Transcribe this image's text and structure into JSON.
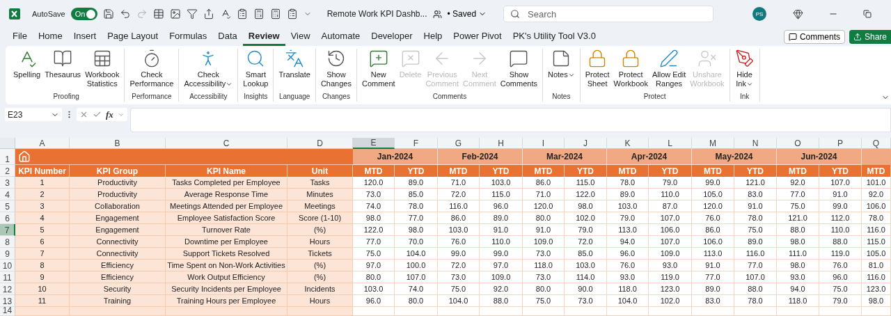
{
  "titlebar": {
    "autosave_label": "AutoSave",
    "autosave": {
      "label": "On",
      "on": true
    },
    "document_title": "Remote Work KPI Dashb...",
    "save_status": "• Saved",
    "search": {
      "placeholder": "Search"
    },
    "user_initials": "PS"
  },
  "menu_tabs": [
    {
      "label": "File",
      "selected": false
    },
    {
      "label": "Home",
      "selected": false
    },
    {
      "label": "Insert",
      "selected": false
    },
    {
      "label": "Page Layout",
      "selected": false
    },
    {
      "label": "Formulas",
      "selected": false
    },
    {
      "label": "Data",
      "selected": false
    },
    {
      "label": "Review",
      "selected": true
    },
    {
      "label": "View",
      "selected": false
    },
    {
      "label": "Automate",
      "selected": false
    },
    {
      "label": "Developer",
      "selected": false
    },
    {
      "label": "Help",
      "selected": false
    },
    {
      "label": "Power Pivot",
      "selected": false
    },
    {
      "label": "PK's Utility Tool V3.0",
      "selected": false
    }
  ],
  "comments_button": "Comments",
  "share_button": "Share",
  "ribbon_groups": [
    {
      "label": "Proofing",
      "commands": [
        {
          "label": "Spelling",
          "disabled": false,
          "dropdown": false
        },
        {
          "label": "Thesaurus",
          "disabled": false,
          "dropdown": false
        },
        {
          "label": "Workbook\nStatistics",
          "disabled": false,
          "dropdown": false
        }
      ]
    },
    {
      "label": "Performance",
      "commands": [
        {
          "label": "Check\nPerformance",
          "disabled": false,
          "dropdown": false
        }
      ]
    },
    {
      "label": "Accessibility",
      "commands": [
        {
          "label": "Check\nAccessibility",
          "disabled": false,
          "dropdown": true
        }
      ]
    },
    {
      "label": "Insights",
      "commands": [
        {
          "label": "Smart\nLookup",
          "disabled": false,
          "dropdown": false
        }
      ]
    },
    {
      "label": "Language",
      "commands": [
        {
          "label": "Translate",
          "disabled": false,
          "dropdown": false
        }
      ]
    },
    {
      "label": "Changes",
      "commands": [
        {
          "label": "Show\nChanges",
          "disabled": false,
          "dropdown": false
        }
      ]
    },
    {
      "label": "Comments",
      "commands": [
        {
          "label": "New\nComment",
          "disabled": false,
          "dropdown": false
        },
        {
          "label": "Delete",
          "disabled": true,
          "dropdown": false
        },
        {
          "label": "Previous\nComment",
          "disabled": true,
          "dropdown": false
        },
        {
          "label": "Next\nComment",
          "disabled": true,
          "dropdown": false
        },
        {
          "label": "Show\nComments",
          "disabled": false,
          "dropdown": false
        }
      ]
    },
    {
      "label": "Notes",
      "commands": [
        {
          "label": "Notes",
          "disabled": false,
          "dropdown": true
        }
      ]
    },
    {
      "label": "Protect",
      "commands": [
        {
          "label": "Protect\nSheet",
          "disabled": false,
          "dropdown": false
        },
        {
          "label": "Protect\nWorkbook",
          "disabled": false,
          "dropdown": false
        },
        {
          "label": "Allow Edit\nRanges",
          "disabled": false,
          "dropdown": false
        },
        {
          "label": "Unshare\nWorkbook",
          "disabled": true,
          "dropdown": false
        }
      ]
    },
    {
      "label": "Ink",
      "commands": [
        {
          "label": "Hide\nInk",
          "disabled": false,
          "dropdown": true
        }
      ]
    }
  ],
  "formula_bar": {
    "name_box": "E23",
    "fx": "fx"
  },
  "sheet": {
    "columns": [
      {
        "label": "A",
        "selected": false
      },
      {
        "label": "B",
        "selected": false
      },
      {
        "label": "C",
        "selected": false
      },
      {
        "label": "D",
        "selected": false
      },
      {
        "label": "E",
        "selected": true
      },
      {
        "label": "F",
        "selected": false
      },
      {
        "label": "G",
        "selected": false
      },
      {
        "label": "H",
        "selected": false
      },
      {
        "label": "I",
        "selected": false
      },
      {
        "label": "J",
        "selected": false
      },
      {
        "label": "K",
        "selected": false
      },
      {
        "label": "L",
        "selected": false
      },
      {
        "label": "M",
        "selected": false
      },
      {
        "label": "N",
        "selected": false
      },
      {
        "label": "O",
        "selected": false
      },
      {
        "label": "P",
        "selected": false
      },
      {
        "label": "Q",
        "selected": false
      }
    ],
    "header_row_numbers": [
      {
        "label": "1",
        "selected": false
      },
      {
        "label": "2",
        "selected": false
      }
    ],
    "months": [
      "Jan-2024",
      "Feb-2024",
      "Mar-2024",
      "Apr-2024",
      "May-2024",
      "Jun-2024"
    ],
    "headers": [
      "KPI Number",
      "KPI Group",
      "KPI Name",
      "Unit"
    ],
    "measures": [
      "MTD",
      "YTD",
      "MTD",
      "YTD",
      "MTD",
      "YTD",
      "MTD",
      "YTD",
      "MTD",
      "YTD",
      "MTD",
      "YTD",
      "MTD"
    ],
    "rows": [
      {
        "row": "3",
        "selected": false,
        "cells": [
          "1",
          "Productivity",
          "Tasks Completed per Employee",
          "Tasks"
        ],
        "values": [
          "120.0",
          "89.0",
          "71.0",
          "103.0",
          "86.0",
          "115.0",
          "78.0",
          "79.0",
          "99.0",
          "121.0",
          "92.0",
          "107.0",
          "101.0"
        ]
      },
      {
        "row": "4",
        "selected": false,
        "cells": [
          "2",
          "Productivity",
          "Average Response Time",
          "Minutes"
        ],
        "values": [
          "73.0",
          "85.0",
          "72.0",
          "115.0",
          "71.0",
          "122.0",
          "89.0",
          "110.0",
          "105.0",
          "83.0",
          "77.0",
          "91.0",
          "92.0"
        ]
      },
      {
        "row": "5",
        "selected": false,
        "cells": [
          "3",
          "Collaboration",
          "Meetings Attended per Employee",
          "Meetings"
        ],
        "values": [
          "74.0",
          "78.0",
          "116.0",
          "96.0",
          "120.0",
          "98.0",
          "103.0",
          "87.0",
          "120.0",
          "91.0",
          "75.0",
          "99.0",
          "106.0"
        ]
      },
      {
        "row": "6",
        "selected": false,
        "cells": [
          "4",
          "Engagement",
          "Employee Satisfaction Score",
          "Score (1-10)"
        ],
        "values": [
          "98.0",
          "77.0",
          "86.0",
          "89.0",
          "80.0",
          "102.0",
          "79.0",
          "107.0",
          "76.0",
          "78.0",
          "121.0",
          "112.0",
          "78.0"
        ]
      },
      {
        "row": "7",
        "selected": true,
        "cells": [
          "5",
          "Engagement",
          "Turnover Rate",
          "(%)"
        ],
        "values": [
          "122.0",
          "98.0",
          "103.0",
          "91.0",
          "91.0",
          "79.0",
          "113.0",
          "106.0",
          "86.0",
          "75.0",
          "88.0",
          "110.0",
          "116.0"
        ]
      },
      {
        "row": "8",
        "selected": false,
        "cells": [
          "6",
          "Connectivity",
          "Downtime per Employee",
          "Hours"
        ],
        "values": [
          "77.0",
          "70.0",
          "76.0",
          "110.0",
          "109.0",
          "72.0",
          "94.0",
          "107.0",
          "106.0",
          "89.0",
          "98.0",
          "88.0",
          "115.0"
        ]
      },
      {
        "row": "9",
        "selected": false,
        "cells": [
          "7",
          "Connectivity",
          "Support Tickets Resolved",
          "Tickets"
        ],
        "values": [
          "75.0",
          "104.0",
          "99.0",
          "99.0",
          "73.0",
          "85.0",
          "96.0",
          "109.0",
          "113.0",
          "116.0",
          "111.0",
          "119.0",
          "105.0"
        ]
      },
      {
        "row": "10",
        "selected": false,
        "cells": [
          "8",
          "Efficiency",
          "Time Spent on Non-Work Activities",
          "(%)"
        ],
        "values": [
          "97.0",
          "100.0",
          "72.0",
          "97.0",
          "118.0",
          "103.0",
          "76.0",
          "93.0",
          "91.0",
          "77.0",
          "98.0",
          "76.0",
          "81.0"
        ]
      },
      {
        "row": "11",
        "selected": false,
        "cells": [
          "9",
          "Efficiency",
          "Work Output Efficiency",
          "(%)"
        ],
        "values": [
          "80.0",
          "107.0",
          "73.0",
          "109.0",
          "73.0",
          "114.0",
          "93.0",
          "119.0",
          "77.0",
          "107.0",
          "93.0",
          "96.0",
          "116.0"
        ]
      },
      {
        "row": "12",
        "selected": false,
        "cells": [
          "10",
          "Security",
          "Security Incidents per Employee",
          "Incidents"
        ],
        "values": [
          "103.0",
          "74.0",
          "75.0",
          "92.0",
          "80.0",
          "90.0",
          "118.0",
          "123.0",
          "89.0",
          "88.0",
          "94.0",
          "75.0",
          "123.0"
        ]
      },
      {
        "row": "13",
        "selected": false,
        "cells": [
          "11",
          "Training",
          "Training Hours per Employee",
          "Hours"
        ],
        "values": [
          "96.0",
          "80.0",
          "104.0",
          "88.0",
          "75.0",
          "73.0",
          "104.0",
          "102.0",
          "83.0",
          "78.0",
          "118.0",
          "79.0",
          "98.0"
        ]
      }
    ],
    "empty_rows": [
      {
        "row": "14",
        "selected": false
      }
    ]
  }
}
